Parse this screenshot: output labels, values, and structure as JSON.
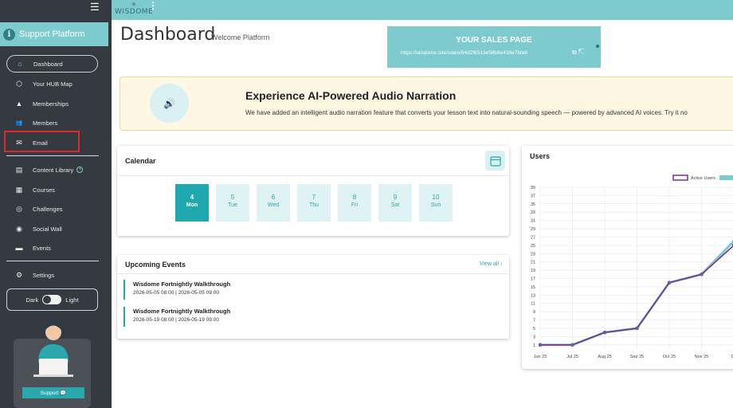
{
  "topbar": {
    "logo_text": "WISDOME",
    "logo_mark": "✳",
    "menu_icon": "⋮"
  },
  "sidebar": {
    "hamburger_icon": "☰",
    "brand": {
      "icon_letter": "i",
      "title": "Support Platform"
    },
    "items": [
      {
        "label": "Dashboard",
        "icon": "⌂",
        "icon_name": "home-icon"
      },
      {
        "label": "Your HUB Map",
        "icon": "⬡",
        "icon_name": "hub-map-icon"
      },
      {
        "label": "Memberships",
        "icon": "▲",
        "icon_name": "memberships-icon"
      },
      {
        "label": "Members",
        "icon": "👥",
        "icon_name": "members-icon"
      },
      {
        "label": "Email",
        "icon": "✉",
        "icon_name": "email-icon"
      },
      {
        "label": "Content Library",
        "icon": "▤",
        "icon_name": "content-library-icon",
        "extra": "+"
      },
      {
        "label": "Courses",
        "icon": "▦",
        "icon_name": "courses-icon"
      },
      {
        "label": "Challenges",
        "icon": "◎",
        "icon_name": "challenges-icon"
      },
      {
        "label": "Social Wall",
        "icon": "◉",
        "icon_name": "social-wall-icon"
      },
      {
        "label": "Events",
        "icon": "▬",
        "icon_name": "events-icon"
      },
      {
        "label": "Settings",
        "icon": "⚙",
        "icon_name": "settings-icon"
      }
    ],
    "theme": {
      "dark_label": "Dark",
      "light_label": "Light"
    },
    "support_label": "Support 💬"
  },
  "header": {
    "title": "Dashboard",
    "subtitle": "Welcome Platform"
  },
  "sales": {
    "title": "YOUR SALES PAGE",
    "url": "https://wisdome.site/sales/64d2f6513e58b6e438e7bfa6",
    "icons": "⧉ ⇱"
  },
  "banner": {
    "icon": "🔊",
    "title": "Experience AI-Powered Audio Narration",
    "description": "We have added an intelligent audio narration feature that converts your lesson text into natural-sounding speech — powered by advanced AI voices. Try it no"
  },
  "calendar": {
    "title": "Calendar",
    "days": [
      {
        "num": "4",
        "name": "Mon",
        "active": true
      },
      {
        "num": "5",
        "name": "Tue",
        "active": false
      },
      {
        "num": "6",
        "name": "Wed",
        "active": false
      },
      {
        "num": "7",
        "name": "Thu",
        "active": false
      },
      {
        "num": "8",
        "name": "Fri",
        "active": false
      },
      {
        "num": "9",
        "name": "Sat",
        "active": false
      },
      {
        "num": "10",
        "name": "Sun",
        "active": false
      }
    ]
  },
  "events": {
    "title": "Upcoming Events",
    "view_all": "View all ›",
    "items": [
      {
        "title": "Wisdome Fortnightly Walkthrough",
        "date": "2026-05-05 08:00 | 2026-05-05 09:00"
      },
      {
        "title": "Wisdome Fortnightly Walkthrough",
        "date": "2026-05-19 08:00 | 2026-05-19 09:00"
      }
    ]
  },
  "users": {
    "title": "Users",
    "chart_data": {
      "type": "line",
      "title": "",
      "categories": [
        "Jun 25",
        "Jul 25",
        "Aug 25",
        "Sep 25",
        "Oct 25",
        "Nov 25",
        "De"
      ],
      "yticks": [
        1,
        3,
        5,
        7,
        9,
        11,
        13,
        15,
        17,
        19,
        21,
        23,
        25,
        27,
        29,
        31,
        33,
        35,
        37,
        39
      ],
      "ylim": [
        0,
        39
      ],
      "grid": true,
      "legend_placement": "top-right",
      "series": [
        {
          "name": "Active Users",
          "color": "#7b2d8e",
          "values": [
            1,
            1,
            4,
            5,
            16,
            18,
            25
          ]
        },
        {
          "name": "",
          "color": "#7ecbcf",
          "values": [
            1,
            1,
            4,
            5,
            16,
            18,
            26
          ]
        }
      ]
    }
  }
}
